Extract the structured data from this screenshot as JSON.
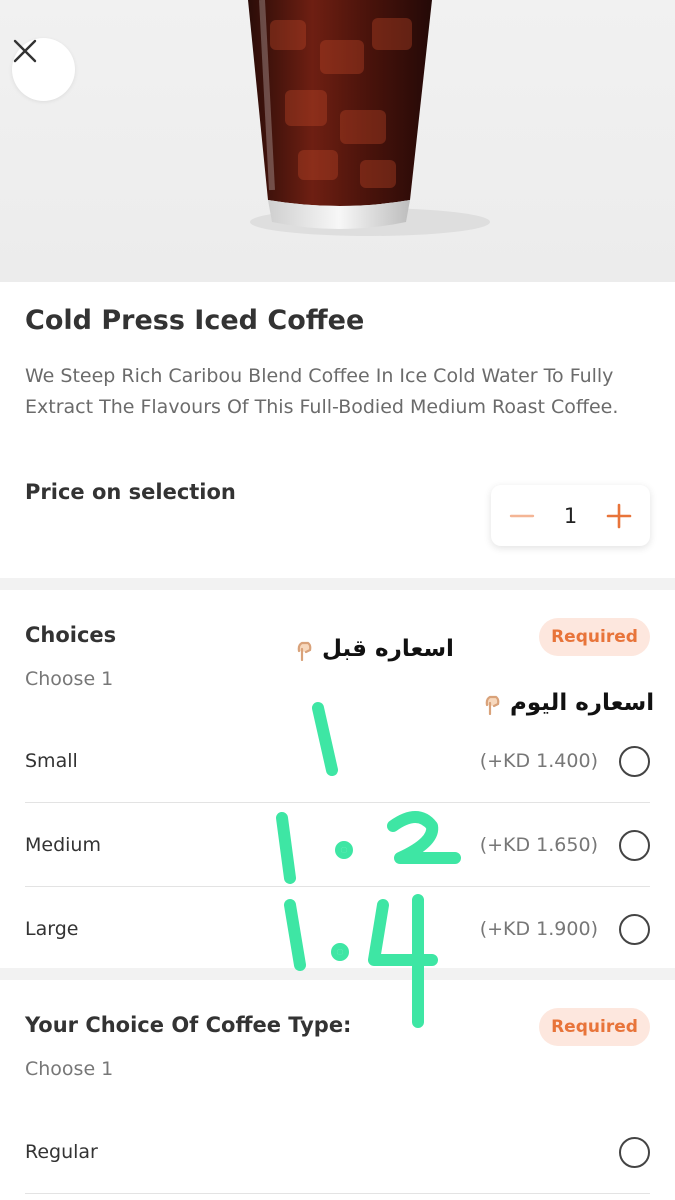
{
  "header": {
    "close_icon": "close-icon",
    "image_subject": "iced coffee glass"
  },
  "product": {
    "title": "Cold Press Iced Coffee",
    "description": "We Steep Rich Caribou Blend Coffee In Ice Cold Water To Fully Extract The Flavours Of This Full-Bodied Medium Roast Coffee.",
    "price_label": "Price on selection"
  },
  "stepper": {
    "minus_icon": "minus-icon",
    "plus_icon": "plus-icon",
    "quantity": "1",
    "accent_color": "#e8743a"
  },
  "choices": {
    "title": "Choices",
    "subtitle": "Choose 1",
    "badge": "Required",
    "options": [
      {
        "label": "Small",
        "price": "(+KD 1.400)"
      },
      {
        "label": "Medium",
        "price": "(+KD 1.650)"
      },
      {
        "label": "Large",
        "price": "(+KD 1.900)"
      }
    ]
  },
  "coffee_type": {
    "title": "Your Choice Of Coffee Type:",
    "subtitle": "Choose 1",
    "badge": "Required",
    "options": [
      {
        "label": "Regular",
        "price": ""
      }
    ]
  },
  "annotations": {
    "note_before": "اسعاره قبل",
    "note_today": "اسعاره اليوم",
    "handwritten_prices": [
      "1",
      "1.2",
      "1.4"
    ],
    "pointing_icon": "pointing-down-hand-icon",
    "marker_color": "#3ee6a4"
  }
}
